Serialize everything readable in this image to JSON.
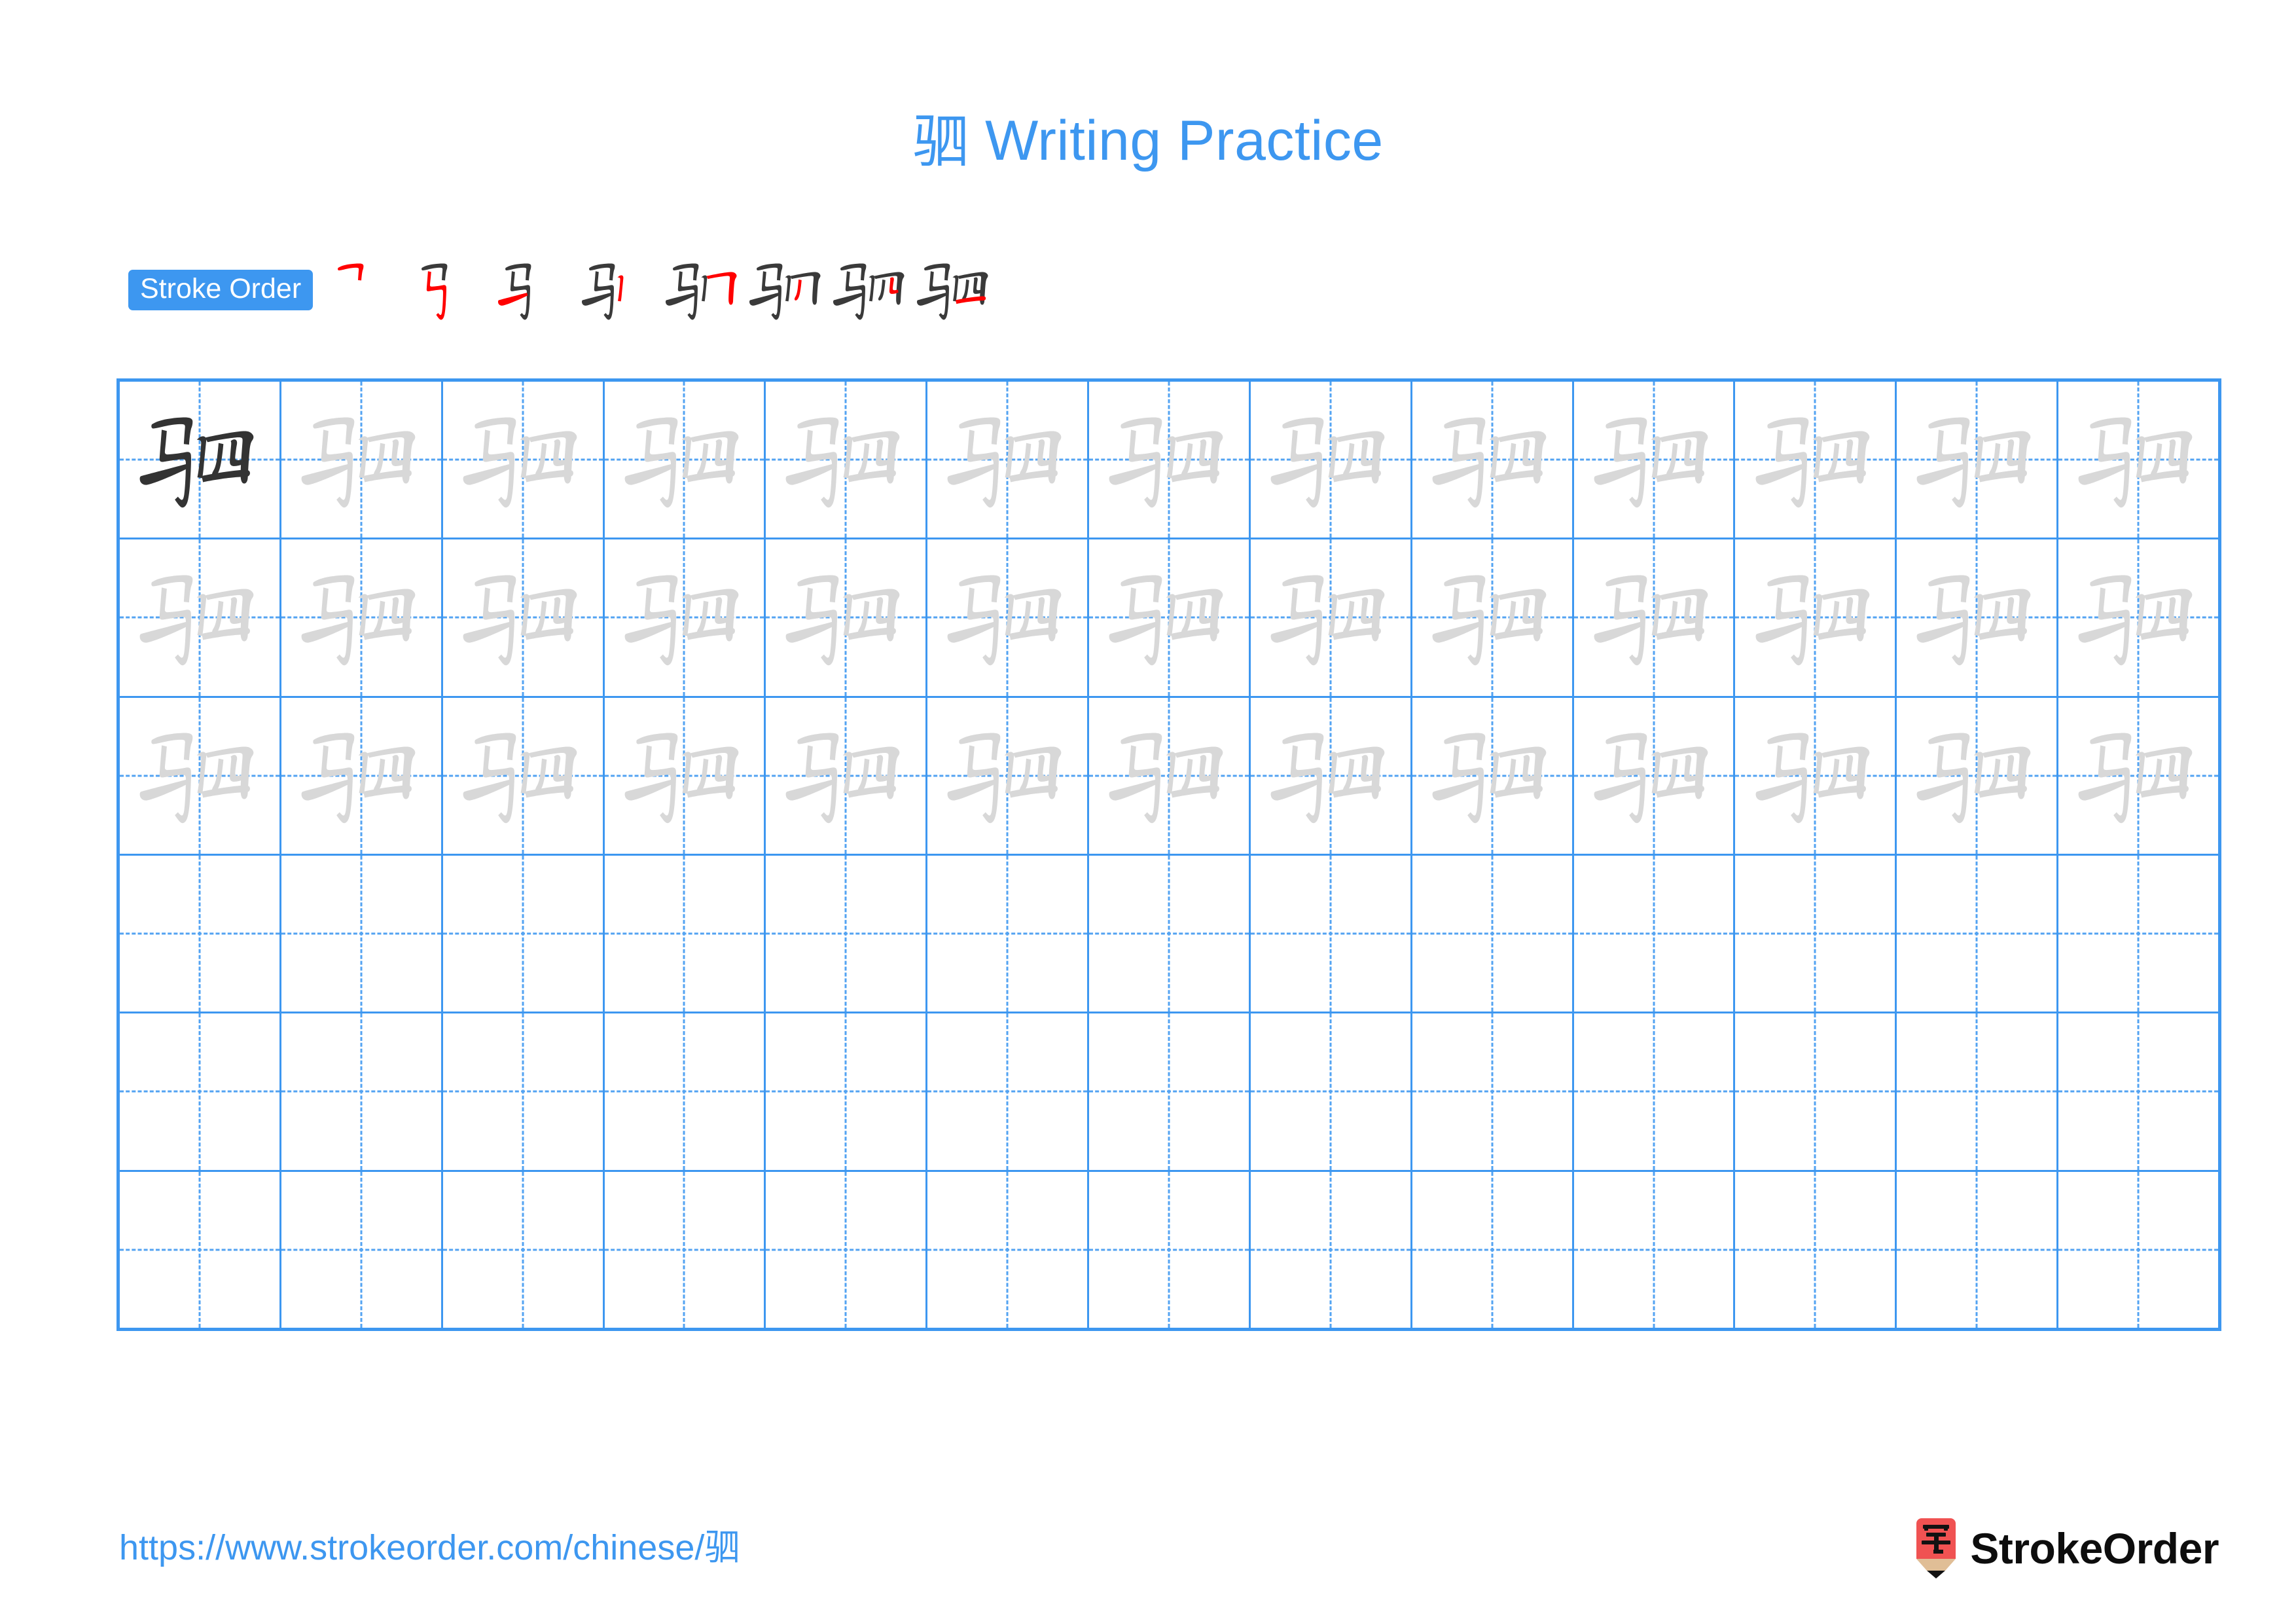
{
  "character": "驷",
  "title": {
    "character": "驷",
    "text": " Writing Practice",
    "full": "驷 Writing Practice",
    "color": "#3d97f0"
  },
  "stroke_order": {
    "label": "Stroke Order",
    "badge_bg": "#3d97f0",
    "badge_text_color": "#ffffff",
    "total_strokes": 8,
    "new_stroke_color": "#ff0000",
    "prior_stroke_color": "#3a3a3a",
    "steps": [
      {
        "index": 1,
        "strokes_shown": 1,
        "new_stroke": "horizontal-fold"
      },
      {
        "index": 2,
        "strokes_shown": 2,
        "new_stroke": "vertical-fold-hook"
      },
      {
        "index": 3,
        "strokes_shown": 3,
        "new_stroke": "horizontal"
      },
      {
        "index": 4,
        "strokes_shown": 4,
        "new_stroke": "vertical"
      },
      {
        "index": 5,
        "strokes_shown": 5,
        "new_stroke": "vertical-fold"
      },
      {
        "index": 6,
        "strokes_shown": 6,
        "new_stroke": "vertical-inner-left"
      },
      {
        "index": 7,
        "strokes_shown": 7,
        "new_stroke": "vertical-inner-right"
      },
      {
        "index": 8,
        "strokes_shown": 8,
        "new_stroke": "horizontal-bottom"
      }
    ]
  },
  "practice_grid": {
    "columns": 13,
    "rows": 6,
    "border_color": "#3d97f0",
    "guide_color": "#53a3f2",
    "solid_char_color": "#333333",
    "trace_char_color": "#d8d8d8",
    "cells": [
      [
        "solid",
        "trace",
        "trace",
        "trace",
        "trace",
        "trace",
        "trace",
        "trace",
        "trace",
        "trace",
        "trace",
        "trace",
        "trace"
      ],
      [
        "trace",
        "trace",
        "trace",
        "trace",
        "trace",
        "trace",
        "trace",
        "trace",
        "trace",
        "trace",
        "trace",
        "trace",
        "trace"
      ],
      [
        "trace",
        "trace",
        "trace",
        "trace",
        "trace",
        "trace",
        "trace",
        "trace",
        "trace",
        "trace",
        "trace",
        "trace",
        "trace"
      ],
      [
        "empty",
        "empty",
        "empty",
        "empty",
        "empty",
        "empty",
        "empty",
        "empty",
        "empty",
        "empty",
        "empty",
        "empty",
        "empty"
      ],
      [
        "empty",
        "empty",
        "empty",
        "empty",
        "empty",
        "empty",
        "empty",
        "empty",
        "empty",
        "empty",
        "empty",
        "empty",
        "empty"
      ],
      [
        "empty",
        "empty",
        "empty",
        "empty",
        "empty",
        "empty",
        "empty",
        "empty",
        "empty",
        "empty",
        "empty",
        "empty",
        "empty"
      ]
    ]
  },
  "footer": {
    "url": "https://www.strokeorder.com/chinese/驷",
    "url_color": "#3d97f0",
    "brand_name": "StrokeOrder",
    "brand_color": "#0d0d0d",
    "logo_char": "字",
    "logo_body_color": "#f05252",
    "logo_taper_color": "#e0be96",
    "logo_tip_color": "#121212"
  }
}
